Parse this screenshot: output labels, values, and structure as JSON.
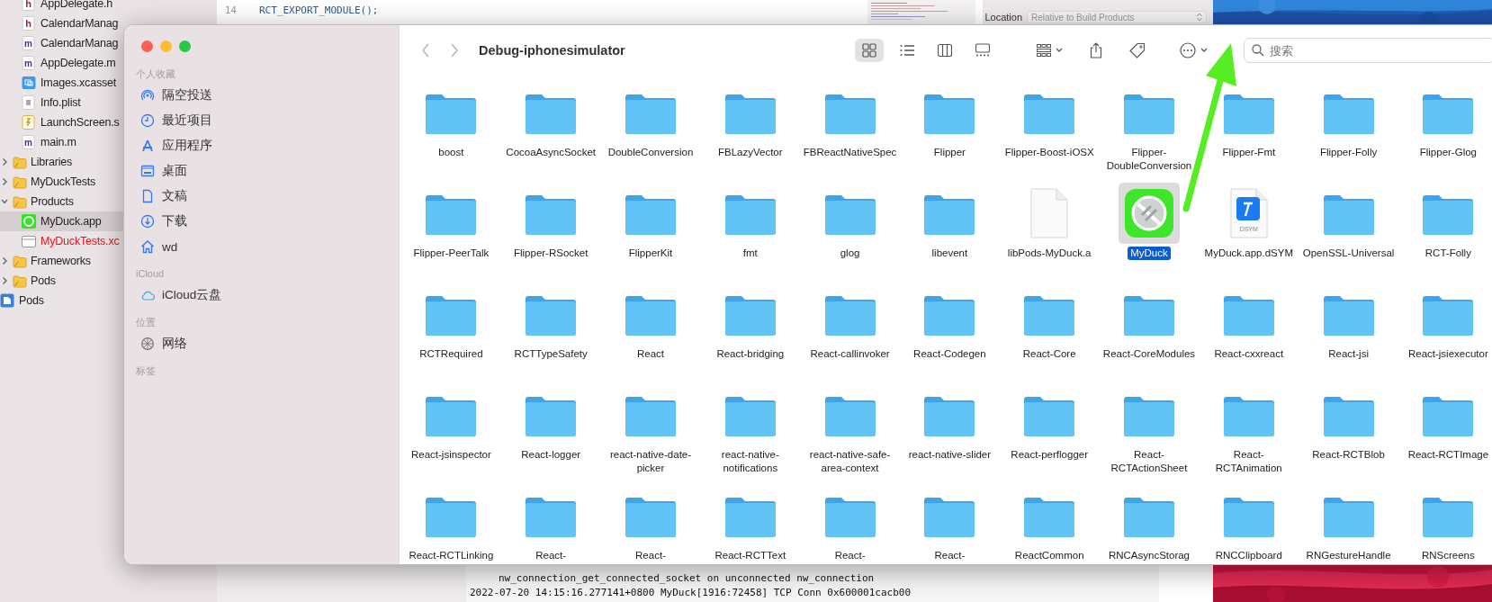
{
  "xcode": {
    "navigator": {
      "files": [
        {
          "name": "AppDelegate.h",
          "kind": "h"
        },
        {
          "name": "CalendarManag",
          "kind": "h"
        },
        {
          "name": "CalendarManag",
          "kind": "m"
        },
        {
          "name": "AppDelegate.m",
          "kind": "m"
        },
        {
          "name": "Images.xcasset",
          "kind": "assets"
        },
        {
          "name": "Info.plist",
          "kind": "plist"
        },
        {
          "name": "LaunchScreen.s",
          "kind": "storyboard"
        },
        {
          "name": "main.m",
          "kind": "m"
        }
      ],
      "groups": [
        {
          "name": "Libraries",
          "kind": "group",
          "expanded": false
        },
        {
          "name": "MyDuckTests",
          "kind": "group",
          "expanded": false
        },
        {
          "name": "Products",
          "kind": "group",
          "expanded": true,
          "children": [
            {
              "name": "MyDuck.app",
              "kind": "app",
              "selected": true,
              "missing": false
            },
            {
              "name": "MyDuckTests.xc",
              "kind": "bundle",
              "selected": false,
              "missing": true
            }
          ]
        },
        {
          "name": "Frameworks",
          "kind": "group",
          "expanded": false
        },
        {
          "name": "Pods",
          "kind": "group",
          "expanded": false
        },
        {
          "name": "Pods",
          "kind": "project"
        }
      ]
    },
    "editor": {
      "lines": [
        {
          "number": "14",
          "code": "RCT_EXPORT_MODULE();"
        }
      ]
    },
    "inspector": {
      "label": "Location",
      "value": "Relative to Build Products"
    },
    "console": {
      "lines": [
        {
          "text": "nw_connection_get_connected_socket on unconnected nw_connection",
          "indent": true
        },
        {
          "text": "2022-07-20 14:15:16.277141+0800 MyDuck[1916:72458] TCP Conn 0x600001cacb00",
          "indent": false
        }
      ]
    }
  },
  "finder": {
    "sidebar": {
      "sections": [
        {
          "title": "个人收藏",
          "items": [
            {
              "label": "隔空投送",
              "kind": "airdrop"
            },
            {
              "label": "最近项目",
              "kind": "recents"
            },
            {
              "label": "应用程序",
              "kind": "applications"
            },
            {
              "label": "桌面",
              "kind": "desktop"
            },
            {
              "label": "文稿",
              "kind": "documents"
            },
            {
              "label": "下载",
              "kind": "downloads"
            },
            {
              "label": "wd",
              "kind": "home"
            }
          ]
        },
        {
          "title": "iCloud",
          "items": [
            {
              "label": "iCloud云盘",
              "kind": "icloud"
            }
          ]
        },
        {
          "title": "位置",
          "items": [
            {
              "label": "网络",
              "kind": "network"
            }
          ]
        },
        {
          "title": "标签"
        }
      ]
    },
    "toolbar": {
      "title": "Debug-iphonesimulator",
      "views": [
        {
          "kind": "icon",
          "selected": true
        },
        {
          "kind": "list",
          "selected": false
        },
        {
          "kind": "column",
          "selected": false
        },
        {
          "kind": "gallery",
          "selected": false
        }
      ],
      "search": {
        "placeholder": "搜索"
      }
    },
    "items": [
      {
        "label": "boost",
        "kind": "folder",
        "selected": false
      },
      {
        "label": "CocoaAsyncSocket",
        "kind": "folder",
        "selected": false
      },
      {
        "label": "DoubleConversion",
        "kind": "folder",
        "selected": false
      },
      {
        "label": "FBLazyVector",
        "kind": "folder",
        "selected": false
      },
      {
        "label": "FBReactNativeSpec",
        "kind": "folder",
        "selected": false
      },
      {
        "label": "Flipper",
        "kind": "folder",
        "selected": false
      },
      {
        "label": "Flipper-Boost-iOSX",
        "kind": "folder",
        "selected": false
      },
      {
        "label": "Flipper-DoubleConversion",
        "kind": "folder",
        "selected": false
      },
      {
        "label": "Flipper-Fmt",
        "kind": "folder",
        "selected": false
      },
      {
        "label": "Flipper-Folly",
        "kind": "folder",
        "selected": false
      },
      {
        "label": "Flipper-Glog",
        "kind": "folder",
        "selected": false
      },
      {
        "label": "Flipper-PeerTalk",
        "kind": "folder",
        "selected": false
      },
      {
        "label": "Flipper-RSocket",
        "kind": "folder",
        "selected": false
      },
      {
        "label": "FlipperKit",
        "kind": "folder",
        "selected": false
      },
      {
        "label": "fmt",
        "kind": "folder",
        "selected": false
      },
      {
        "label": "glog",
        "kind": "folder",
        "selected": false
      },
      {
        "label": "libevent",
        "kind": "folder",
        "selected": false
      },
      {
        "label": "libPods-MyDuck.a",
        "kind": "file",
        "selected": false
      },
      {
        "label": "MyDuck",
        "kind": "app",
        "selected": true
      },
      {
        "label": "MyDuck.app.dSYM",
        "kind": "dsym",
        "selected": false,
        "badge": "DSYM"
      },
      {
        "label": "OpenSSL-Universal",
        "kind": "folder",
        "selected": false
      },
      {
        "label": "RCT-Folly",
        "kind": "folder",
        "selected": false
      },
      {
        "label": "RCTRequired",
        "kind": "folder",
        "selected": false
      },
      {
        "label": "RCTTypeSafety",
        "kind": "folder",
        "selected": false
      },
      {
        "label": "React",
        "kind": "folder",
        "selected": false
      },
      {
        "label": "React-bridging",
        "kind": "folder",
        "selected": false
      },
      {
        "label": "React-callinvoker",
        "kind": "folder",
        "selected": false
      },
      {
        "label": "React-Codegen",
        "kind": "folder",
        "selected": false
      },
      {
        "label": "React-Core",
        "kind": "folder",
        "selected": false
      },
      {
        "label": "React-CoreModules",
        "kind": "folder",
        "selected": false
      },
      {
        "label": "React-cxxreact",
        "kind": "folder",
        "selected": false
      },
      {
        "label": "React-jsi",
        "kind": "folder",
        "selected": false
      },
      {
        "label": "React-jsiexecutor",
        "kind": "folder",
        "selected": false
      },
      {
        "label": "React-jsinspector",
        "kind": "folder",
        "selected": false
      },
      {
        "label": "React-logger",
        "kind": "folder",
        "selected": false
      },
      {
        "label": "react-native-date-picker",
        "kind": "folder",
        "selected": false
      },
      {
        "label": "react-native-notifications",
        "kind": "folder",
        "selected": false
      },
      {
        "label": "react-native-safe-area-context",
        "kind": "folder",
        "selected": false
      },
      {
        "label": "react-native-slider",
        "kind": "folder",
        "selected": false
      },
      {
        "label": "React-perflogger",
        "kind": "folder",
        "selected": false
      },
      {
        "label": "React-RCTActionSheet",
        "kind": "folder",
        "selected": false
      },
      {
        "label": "React-RCTAnimation",
        "kind": "folder",
        "selected": false
      },
      {
        "label": "React-RCTBlob",
        "kind": "folder",
        "selected": false
      },
      {
        "label": "React-RCTImage",
        "kind": "folder",
        "selected": false
      },
      {
        "label": "React-RCTLinking",
        "kind": "folder",
        "selected": false
      },
      {
        "label": "React-",
        "kind": "folder",
        "selected": false
      },
      {
        "label": "React-",
        "kind": "folder",
        "selected": false
      },
      {
        "label": "React-RCTText",
        "kind": "folder",
        "selected": false
      },
      {
        "label": "React-",
        "kind": "folder",
        "selected": false
      },
      {
        "label": "React-",
        "kind": "folder",
        "selected": false
      },
      {
        "label": "ReactCommon",
        "kind": "folder",
        "selected": false
      },
      {
        "label": "RNCAsyncStorag",
        "kind": "folder",
        "selected": false
      },
      {
        "label": "RNCClipboard",
        "kind": "folder",
        "selected": false
      },
      {
        "label": "RNGestureHandle",
        "kind": "folder",
        "selected": false
      },
      {
        "label": "RNScreens",
        "kind": "folder",
        "selected": false
      }
    ]
  }
}
